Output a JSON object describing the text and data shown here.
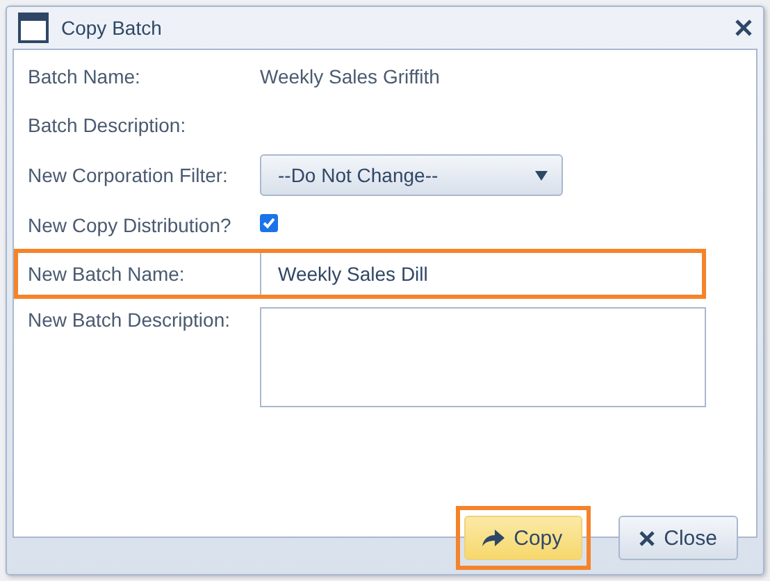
{
  "window": {
    "title": "Copy Batch"
  },
  "fields": [
    {
      "kind": "text",
      "label": "Batch Name:",
      "value": "Weekly Sales Griffith",
      "highlighted": false
    },
    {
      "kind": "text",
      "label": "Batch Description:",
      "highlighted": false
    },
    {
      "kind": "dropdown",
      "label": "New Corporation Filter:",
      "value": "--Do Not Change--",
      "highlighted": false
    },
    {
      "kind": "checkbox",
      "label": "New Copy Distribution?",
      "checked": true,
      "highlighted": false
    },
    {
      "kind": "input",
      "label": "New Batch Name:",
      "value": "Weekly Sales Dill",
      "highlighted": true
    },
    {
      "kind": "textarea",
      "label": "New Batch Description:",
      "highlighted": false
    }
  ],
  "buttons": [
    {
      "kind": "copy",
      "label": "Copy",
      "primary": true,
      "highlighted": true
    },
    {
      "kind": "close",
      "label": "Close",
      "primary": false,
      "highlighted": false
    }
  ]
}
